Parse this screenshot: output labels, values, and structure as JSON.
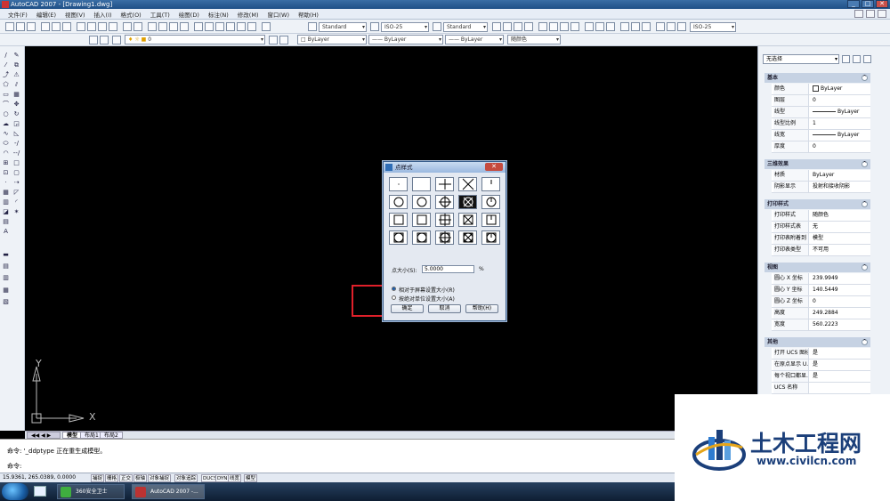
{
  "window": {
    "title": "AutoCAD 2007 - [Drawing1.dwg]"
  },
  "menu": [
    "文件(F)",
    "编辑(E)",
    "视图(V)",
    "插入(I)",
    "格式(O)",
    "工具(T)",
    "绘图(D)",
    "标注(N)",
    "修改(M)",
    "窗口(W)",
    "帮助(H)"
  ],
  "toolbar": {
    "text_style": "Standard",
    "dim_style": "ISO-25",
    "table_style": "Standard",
    "ml_style": "ISO-25",
    "layer": "0",
    "color": "ByLayer",
    "linetype": "ByLayer",
    "lineweight": "ByLayer",
    "plotstyle": "随颜色"
  },
  "tabs": [
    "模型",
    "布局1",
    "布局2"
  ],
  "command": {
    "line1": "命令: '_ddptype 正在重生成模型。",
    "line2": "命令:"
  },
  "status": {
    "coords": "15.9361, 265.0389, 0.0000",
    "buttons": [
      "捕捉",
      "栅格",
      "正交",
      "极轴",
      "对象捕捉",
      "对象追踪",
      "DUCS",
      "DYN",
      "线宽",
      "模型"
    ]
  },
  "taskbar": {
    "item1": "360安全卫士",
    "item2": "AutoCAD 2007 -..."
  },
  "properties": {
    "selection": "无选择",
    "sections": {
      "basic": "基本",
      "effects3d": "三维效果",
      "plotstyle": "打印样式",
      "view": "视图",
      "misc": "其他"
    },
    "basic": [
      {
        "k": "颜色",
        "v": "ByLayer"
      },
      {
        "k": "图层",
        "v": "0"
      },
      {
        "k": "线型",
        "v": "ByLayer"
      },
      {
        "k": "线型比例",
        "v": "1"
      },
      {
        "k": "线宽",
        "v": "ByLayer"
      },
      {
        "k": "厚度",
        "v": "0"
      }
    ],
    "effects3d": [
      {
        "k": "材质",
        "v": "ByLayer"
      },
      {
        "k": "阴影显示",
        "v": "投射和接收阴影"
      }
    ],
    "plotstyle": [
      {
        "k": "打印样式",
        "v": "随颜色"
      },
      {
        "k": "打印样式表",
        "v": "无"
      },
      {
        "k": "打印表附着到",
        "v": "模型"
      },
      {
        "k": "打印表类型",
        "v": "不可用"
      }
    ],
    "view": [
      {
        "k": "圆心 X 坐标",
        "v": "239.9949"
      },
      {
        "k": "圆心 Y 坐标",
        "v": "140.5449"
      },
      {
        "k": "圆心 Z 坐标",
        "v": "0"
      },
      {
        "k": "高度",
        "v": "249.2884"
      },
      {
        "k": "宽度",
        "v": "560.2223"
      }
    ],
    "misc": [
      {
        "k": "打开 UCS 图标",
        "v": "是"
      },
      {
        "k": "在原点显示 U...",
        "v": "是"
      },
      {
        "k": "每个视口都显...",
        "v": "是"
      },
      {
        "k": "UCS 名称",
        "v": ""
      }
    ]
  },
  "dialog": {
    "title": "点样式",
    "size_label": "点大小(S):",
    "size_value": "5.0000",
    "size_unit": "%",
    "radio1": "相对于屏幕设置大小(R)",
    "radio2": "按绝对单位设置大小(A)",
    "ok": "确定",
    "cancel": "取消",
    "help": "帮助(H)"
  },
  "ucs": {
    "x": "X",
    "y": "Y"
  },
  "watermark": {
    "name": "土木工程网",
    "url": "www.civilcn.com"
  }
}
